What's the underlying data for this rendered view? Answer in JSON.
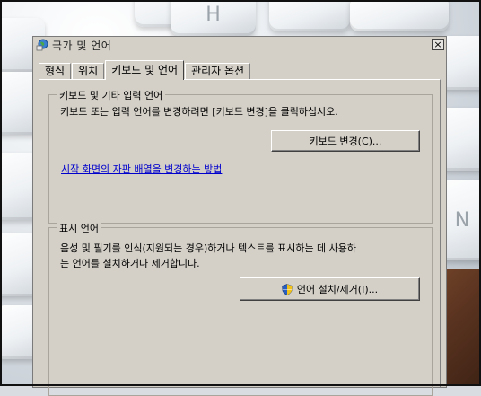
{
  "window": {
    "title": "국가 및 언어",
    "close_label": "×"
  },
  "tabs": [
    {
      "label": "형식",
      "active": false
    },
    {
      "label": "위치",
      "active": false
    },
    {
      "label": "키보드 및 언어",
      "active": true
    },
    {
      "label": "관리자 옵션",
      "active": false
    }
  ],
  "keyboard_group": {
    "title": "키보드 및 기타 입력 언어",
    "description": "키보드 또는 입력 언어를 변경하려면 [키보드 변경]을 클릭하십시오.",
    "button_label": "키보드 변경(C)...",
    "link_text": "시작 화면의 자판 배열을 변경하는 방법"
  },
  "display_group": {
    "title": "표시 언어",
    "description_line1": "음성 및 필기를 인식(지원되는 경우)하거나 텍스트를 표시하는 데 사용하",
    "description_line2": "는 언어를 설치하거나 제거합니다.",
    "button_label": "언어 설치/제거(I)..."
  },
  "background_keys": [
    "H",
    "N"
  ]
}
